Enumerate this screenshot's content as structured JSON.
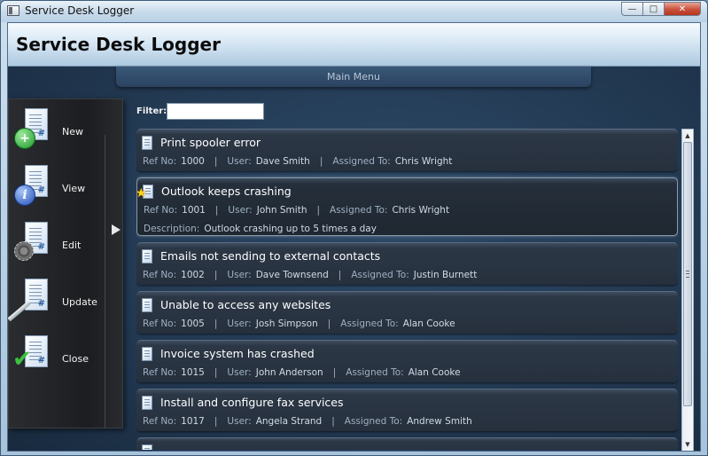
{
  "window": {
    "title": "Service Desk Logger",
    "controls": [
      "minimize",
      "maximize",
      "close"
    ]
  },
  "header": {
    "title": "Service Desk Logger"
  },
  "main_menu": {
    "label": "Main Menu"
  },
  "sidebar": {
    "items": [
      {
        "label": "New",
        "icon": "new-ticket-icon"
      },
      {
        "label": "View",
        "icon": "view-ticket-icon"
      },
      {
        "label": "Edit",
        "icon": "edit-ticket-icon"
      },
      {
        "label": "Update",
        "icon": "update-ticket-icon"
      },
      {
        "label": "Close",
        "icon": "close-ticket-icon"
      }
    ]
  },
  "filter": {
    "label": "Filter:",
    "value": ""
  },
  "labels": {
    "ref": "Ref No:",
    "user": "User:",
    "assigned": "Assigned To:",
    "desc": "Description:",
    "sep": "|"
  },
  "tickets": [
    {
      "title": "Print spooler error",
      "ref": "1000",
      "user": "Dave Smith",
      "assigned": "Chris Wright"
    },
    {
      "title": "Outlook keeps crashing",
      "ref": "1001",
      "user": "John Smith",
      "assigned": "Chris Wright",
      "description": "Outlook crashing up to 5 times a day",
      "selected": true
    },
    {
      "title": "Emails not sending to external contacts",
      "ref": "1002",
      "user": "Dave Townsend",
      "assigned": "Justin Burnett"
    },
    {
      "title": "Unable to access any websites",
      "ref": "1005",
      "user": "Josh Simpson",
      "assigned": "Alan Cooke"
    },
    {
      "title": "Invoice system has crashed",
      "ref": "1015",
      "user": "John Anderson",
      "assigned": "Alan Cooke"
    },
    {
      "title": "Install and configure fax services",
      "ref": "1017",
      "user": "Angela Strand",
      "assigned": "Andrew Smith"
    }
  ]
}
